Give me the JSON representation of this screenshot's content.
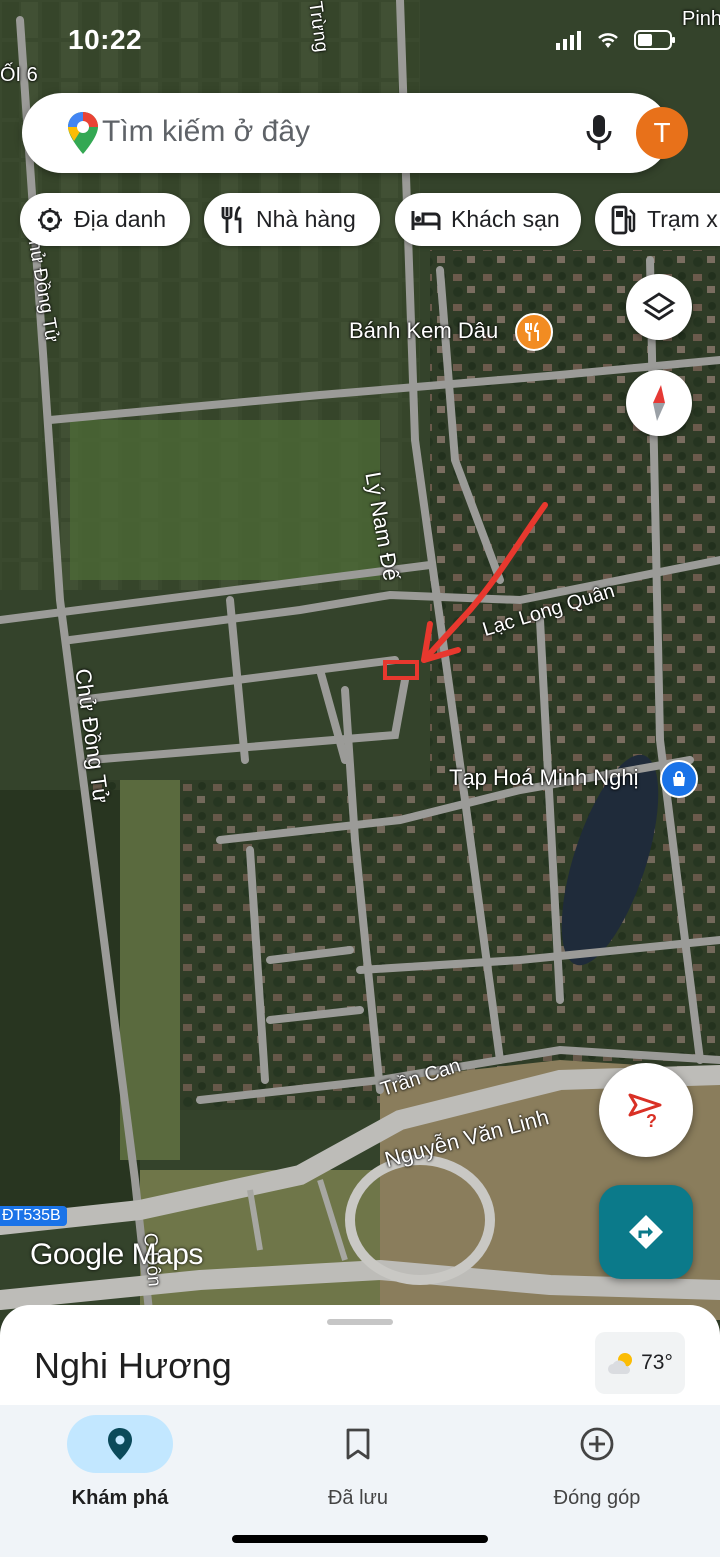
{
  "status_bar": {
    "time": "10:22"
  },
  "search": {
    "placeholder": "Tìm kiếm ở đây",
    "avatar_letter": "T"
  },
  "chips": [
    {
      "label": "Địa danh",
      "icon": "landmark-icon"
    },
    {
      "label": "Nhà hàng",
      "icon": "restaurant-icon"
    },
    {
      "label": "Khách sạn",
      "icon": "hotel-icon"
    },
    {
      "label": "Trạm x",
      "icon": "gas-station-icon"
    }
  ],
  "map": {
    "street_labels": {
      "ly_nam_de": "Lý Nam Đế",
      "lac_long_quan": "Lạc Long Quân",
      "chu_dong_tu_top": "Chử Đồng Tử",
      "chu_dong_tu_mid": "Chử Đồng Tử",
      "tran_can": "Trần Can",
      "nguyen_van_linh": "Nguyễn Văn Linh",
      "trung": "Trừng",
      "pinh": "Pinh",
      "to_6": "ỐI 6",
      "c_don": "C Đôn",
      "dt535b": "ĐT535B"
    },
    "pois": {
      "banh_kem": "Bánh Kem Dâu",
      "tap_hoa": "Tạp Hoá Minh Nghị"
    },
    "attribution": "Google Maps"
  },
  "place_sheet": {
    "title": "Nghi Hương",
    "temperature": "73°"
  },
  "bottom_nav": [
    {
      "label": "Khám phá",
      "icon": "explore-pin-icon",
      "active": true
    },
    {
      "label": "Đã lưu",
      "icon": "bookmark-icon",
      "active": false
    },
    {
      "label": "Đóng góp",
      "icon": "add-circle-icon",
      "active": false
    }
  ],
  "colors": {
    "accent": "#0b7a8a",
    "avatar": "#e8711a",
    "nav_active": "#c2e7ff",
    "annotation_arrow": "#e8382e"
  }
}
